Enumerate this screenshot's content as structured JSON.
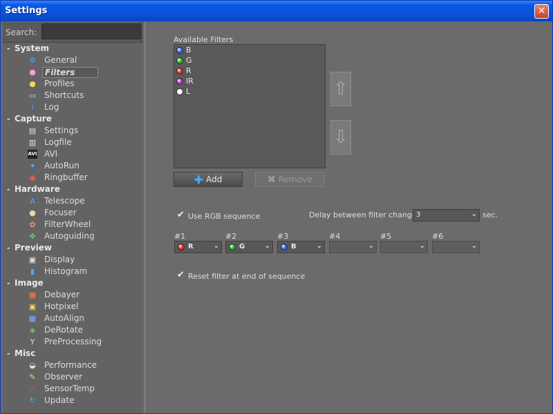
{
  "window": {
    "title": "Settings",
    "close_label": "✕"
  },
  "search": {
    "label": "Search:",
    "value": ""
  },
  "tree": [
    {
      "group": "System",
      "items": [
        {
          "label": "General",
          "icon": "gear-icon",
          "glyph": "⚙",
          "color": "#4aa8ff"
        },
        {
          "label": "Filters",
          "icon": "color-wheel-icon",
          "glyph": "●",
          "color": "#ff9ad8",
          "selected": true
        },
        {
          "label": "Profiles",
          "icon": "profile-icon",
          "glyph": "●",
          "color": "#f5d35a"
        },
        {
          "label": "Shortcuts",
          "icon": "keyboard-icon",
          "glyph": "▭",
          "color": "#d0d0d0"
        },
        {
          "label": "Log",
          "icon": "info-icon",
          "glyph": "i",
          "color": "#4aa8ff"
        }
      ]
    },
    {
      "group": "Capture",
      "items": [
        {
          "label": "Settings",
          "icon": "capture-settings-icon",
          "glyph": "▤",
          "color": "#e0e0e0"
        },
        {
          "label": "Logfile",
          "icon": "logfile-icon",
          "glyph": "▥",
          "color": "#e0e0e0"
        },
        {
          "label": "AVI",
          "icon": "avi-icon",
          "glyph": "AVI",
          "color": "#ffffff"
        },
        {
          "label": "AutoRun",
          "icon": "autorun-icon",
          "glyph": "✦",
          "color": "#4aa8ff"
        },
        {
          "label": "Ringbuffer",
          "icon": "ringbuffer-icon",
          "glyph": "◉",
          "color": "#ff5a4a"
        }
      ]
    },
    {
      "group": "Hardware",
      "items": [
        {
          "label": "Telescope",
          "icon": "telescope-icon",
          "glyph": "A",
          "color": "#4aa8ff"
        },
        {
          "label": "Focuser",
          "icon": "focuser-icon",
          "glyph": "●",
          "color": "#e0e0a0"
        },
        {
          "label": "FilterWheel",
          "icon": "filterwheel-icon",
          "glyph": "✿",
          "color": "#ff8a8a"
        },
        {
          "label": "Autoguiding",
          "icon": "autoguiding-icon",
          "glyph": "✥",
          "color": "#7ac86a"
        }
      ]
    },
    {
      "group": "Preview",
      "items": [
        {
          "label": "Display",
          "icon": "display-icon",
          "glyph": "▣",
          "color": "#e0e0e0"
        },
        {
          "label": "Histogram",
          "icon": "histogram-icon",
          "glyph": "▮",
          "color": "#4aa8ff"
        }
      ]
    },
    {
      "group": "Image",
      "items": [
        {
          "label": "Debayer",
          "icon": "debayer-icon",
          "glyph": "▦",
          "color": "#ff7a3a"
        },
        {
          "label": "Hotpixel",
          "icon": "hotpixel-icon",
          "glyph": "▣",
          "color": "#f5d35a"
        },
        {
          "label": "AutoAlign",
          "icon": "autoalign-icon",
          "glyph": "▦",
          "color": "#8aa8ff"
        },
        {
          "label": "DeRotate",
          "icon": "derotate-icon",
          "glyph": "◈",
          "color": "#7ac86a"
        },
        {
          "label": "PreProcessing",
          "icon": "funnel-icon",
          "glyph": "Y",
          "color": "#e0e0e0"
        }
      ]
    },
    {
      "group": "Misc",
      "items": [
        {
          "label": "Performance",
          "icon": "gauge-icon",
          "glyph": "◒",
          "color": "#e0e0e0"
        },
        {
          "label": "Observer",
          "icon": "pencil-icon",
          "glyph": "✎",
          "color": "#f5d35a"
        },
        {
          "label": "SensorTemp",
          "icon": "thermometer-icon",
          "glyph": "⟋",
          "color": "#ff5a4a"
        },
        {
          "label": "Update",
          "icon": "refresh-icon",
          "glyph": "↻",
          "color": "#4aa8ff"
        }
      ]
    }
  ],
  "filters": {
    "available_label": "Available Filters",
    "list": [
      {
        "name": "B",
        "color": "#2a6aff"
      },
      {
        "name": "G",
        "color": "#2ab82a"
      },
      {
        "name": "R",
        "color": "#e82a1a"
      },
      {
        "name": "IR",
        "color": "#c82ad8"
      },
      {
        "name": "L",
        "color": "#ffffff"
      }
    ],
    "add_label": "Add",
    "remove_label": "Remove",
    "up_glyph": "⇧",
    "down_glyph": "⇩"
  },
  "rgb": {
    "use_rgb_label": "Use RGB sequence",
    "use_rgb_checked": true,
    "delay_label": "Delay between filter change",
    "delay_value": "3",
    "delay_unit": "sec.",
    "slots": [
      {
        "label": "#1",
        "value": "R",
        "color": "#e82a1a"
      },
      {
        "label": "#2",
        "value": "G",
        "color": "#2ab82a"
      },
      {
        "label": "#3",
        "value": "B",
        "color": "#2a6aff"
      },
      {
        "label": "#4",
        "value": "",
        "color": ""
      },
      {
        "label": "#5",
        "value": "",
        "color": ""
      },
      {
        "label": "#6",
        "value": "",
        "color": ""
      }
    ],
    "reset_label": "Reset filter at end of sequence",
    "reset_checked": true
  }
}
